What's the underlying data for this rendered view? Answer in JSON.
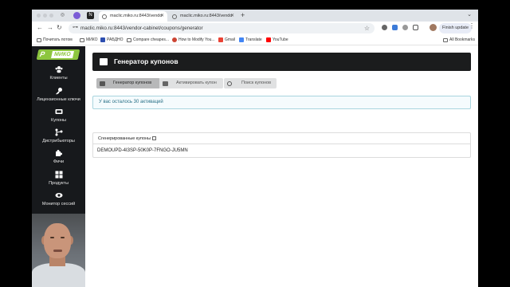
{
  "browser": {
    "tabs": [
      {
        "title": "maclic.miko.ru:8443/vendo",
        "active": true
      },
      {
        "title": "maclic.miko.ru:8443/vendo",
        "active": false
      }
    ],
    "new_tab": "+",
    "url": "maclic.miko.ru:8443/vendor-cabinet/coupons/generator",
    "finish_update": "Finish update",
    "bookmarks": [
      {
        "label": "Почитать потом",
        "icon": "folder-icon"
      },
      {
        "label": "МИКО",
        "icon": "folder-icon"
      },
      {
        "label": "РАБДНО",
        "icon": "site-icon"
      },
      {
        "label": "Compare cheapes...",
        "icon": "site-icon"
      },
      {
        "label": "How to Modify You...",
        "icon": "site-icon"
      },
      {
        "label": "Gmail",
        "icon": "gmail-icon"
      },
      {
        "label": "Translate",
        "icon": "translate-icon"
      },
      {
        "label": "YouTube",
        "icon": "youtube-icon"
      }
    ],
    "all_bookmarks": "All Bookmarks"
  },
  "sidebar": {
    "logo_text": "МИКО",
    "items": [
      {
        "label": "Клиенты",
        "icon": "users-icon"
      },
      {
        "label": "Лицензионные ключи",
        "icon": "key-icon"
      },
      {
        "label": "Купоны",
        "icon": "ticket-icon"
      },
      {
        "label": "Дистрибьюторы",
        "icon": "sitemap-icon"
      },
      {
        "label": "Фичи",
        "icon": "puzzle-icon"
      },
      {
        "label": "Продукты",
        "icon": "grid-icon"
      },
      {
        "label": "Монитор сессий",
        "icon": "eye-icon"
      }
    ]
  },
  "header": {
    "title": "Генератор купонов"
  },
  "page_tabs": [
    {
      "label": "Генератор купонов",
      "active": true
    },
    {
      "label": "Активировать купон",
      "active": false
    },
    {
      "label": "Поиск купонов",
      "active": false
    }
  ],
  "message": "У вас осталось 30 активаций",
  "generated": {
    "title": "Сгенерированные купоны",
    "codes": [
      "DEMOUPD-4I3SP-50K0P-7FNGO-JU5MN"
    ]
  },
  "colors": {
    "accent": "#8dc63f",
    "sidebar_bg": "#17191c",
    "header_bg": "#1b1c1d",
    "info_text": "#276f86"
  }
}
